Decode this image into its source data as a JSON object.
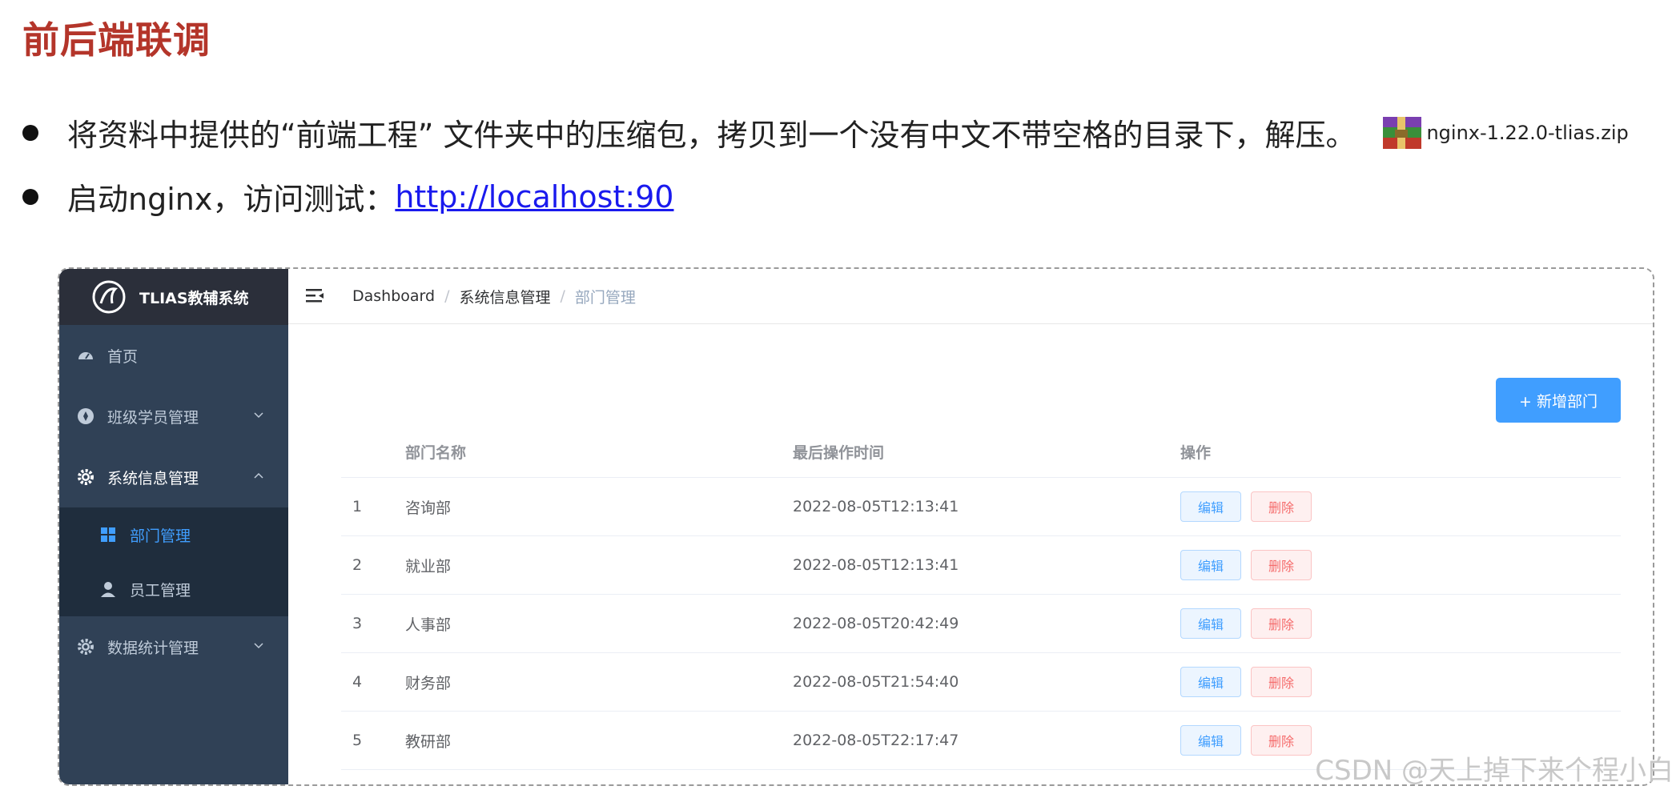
{
  "slide": {
    "title": "前后端联调",
    "bullet1": "将资料中提供的“前端工程” 文件夹中的压缩包，拷贝到一个没有中文不带空格的目录下，解压。",
    "zip_file": "nginx-1.22.0-tlias.zip",
    "bullet2_prefix": "启动nginx，访问测试：",
    "bullet2_link": "http://localhost:90"
  },
  "app": {
    "brand": "TLIAS教辅系统",
    "sidebar": {
      "home": "首页",
      "class_student": "班级学员管理",
      "system_info": "系统信息管理",
      "dept": "部门管理",
      "staff": "员工管理",
      "stats": "数据统计管理"
    },
    "breadcrumb": [
      "Dashboard",
      "系统信息管理",
      "部门管理"
    ],
    "add_button": "+ 新增部门",
    "table": {
      "headers": [
        "部门名称",
        "最后操作时间",
        "操作"
      ],
      "edit_label": "编辑",
      "delete_label": "删除",
      "rows": [
        {
          "idx": "1",
          "name": "咨询部",
          "time": "2022-08-05T12:13:41"
        },
        {
          "idx": "2",
          "name": "就业部",
          "time": "2022-08-05T12:13:41"
        },
        {
          "idx": "3",
          "name": "人事部",
          "time": "2022-08-05T20:42:49"
        },
        {
          "idx": "4",
          "name": "财务部",
          "time": "2022-08-05T21:54:40"
        },
        {
          "idx": "5",
          "name": "教研部",
          "time": "2022-08-05T22:17:47"
        }
      ]
    }
  },
  "watermark": "CSDN @天上掉下来个程小白",
  "colors": {
    "title_red": "#b4352a",
    "sidebar_bg": "#304156",
    "primary": "#409eff",
    "danger": "#f56c6c"
  }
}
